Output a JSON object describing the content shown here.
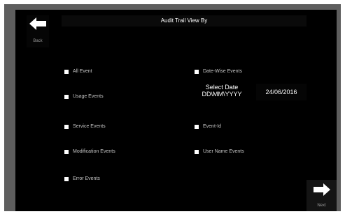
{
  "header": {
    "title": "Audit Trail View By"
  },
  "nav": {
    "back_label": "Back",
    "next_label": "Next"
  },
  "options_left": [
    {
      "label": "All Event"
    },
    {
      "label": "Usage Events"
    },
    {
      "label": "Service Events"
    },
    {
      "label": "Modification Events"
    },
    {
      "label": "Error Events"
    }
  ],
  "options_right": [
    {
      "label": "Date-Wise Events"
    },
    {
      "label": "Event-Id"
    },
    {
      "label": "User Name Events"
    }
  ],
  "date": {
    "label_line1": "Select Date",
    "label_line2": "DD\\MM\\YYYY",
    "value": "24/06/2016"
  },
  "icons": {
    "back": "arrow-left-icon",
    "next": "arrow-right-icon"
  }
}
